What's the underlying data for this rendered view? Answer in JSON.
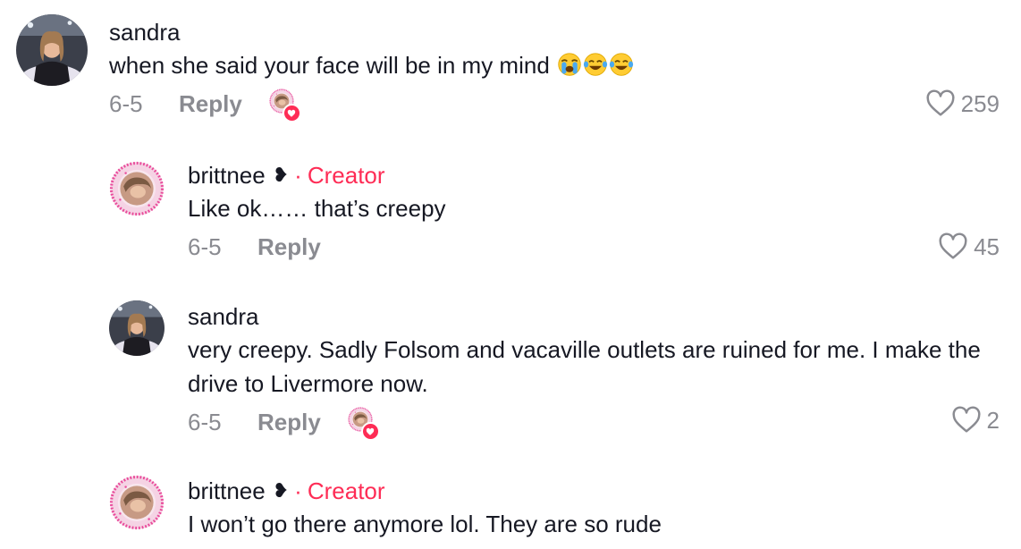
{
  "comments": [
    {
      "username": "sandra",
      "text": "when she said your face will be in my mind",
      "emojis": [
        "loudly-crying-face",
        "face-with-tears-of-joy",
        "face-with-tears-of-joy"
      ],
      "date": "6-5",
      "reply_label": "Reply",
      "likes": "259",
      "liked_by_creator": true
    },
    {
      "username": "brittnee",
      "name_suffix": "❥",
      "creator_label": "Creator",
      "separator": "·",
      "text": "Like ok…… that’s creepy",
      "date": "6-5",
      "reply_label": "Reply",
      "likes": "45"
    },
    {
      "username": "sandra",
      "text": "very creepy. Sadly Folsom and vacaville outlets are ruined for me. I make the drive to Livermore now.",
      "date": "6-5",
      "reply_label": "Reply",
      "likes": "2",
      "liked_by_creator": true
    },
    {
      "username": "brittnee",
      "name_suffix": "❥",
      "creator_label": "Creator",
      "separator": "·",
      "text": "I won’t go there anymore lol. They are so rude"
    }
  ],
  "colors": {
    "accent": "#fe2c55",
    "muted": "#8a8b91",
    "text": "#161823"
  },
  "icons": {
    "like": "heart-outline-icon",
    "creator_like": "heart-badge-icon"
  }
}
